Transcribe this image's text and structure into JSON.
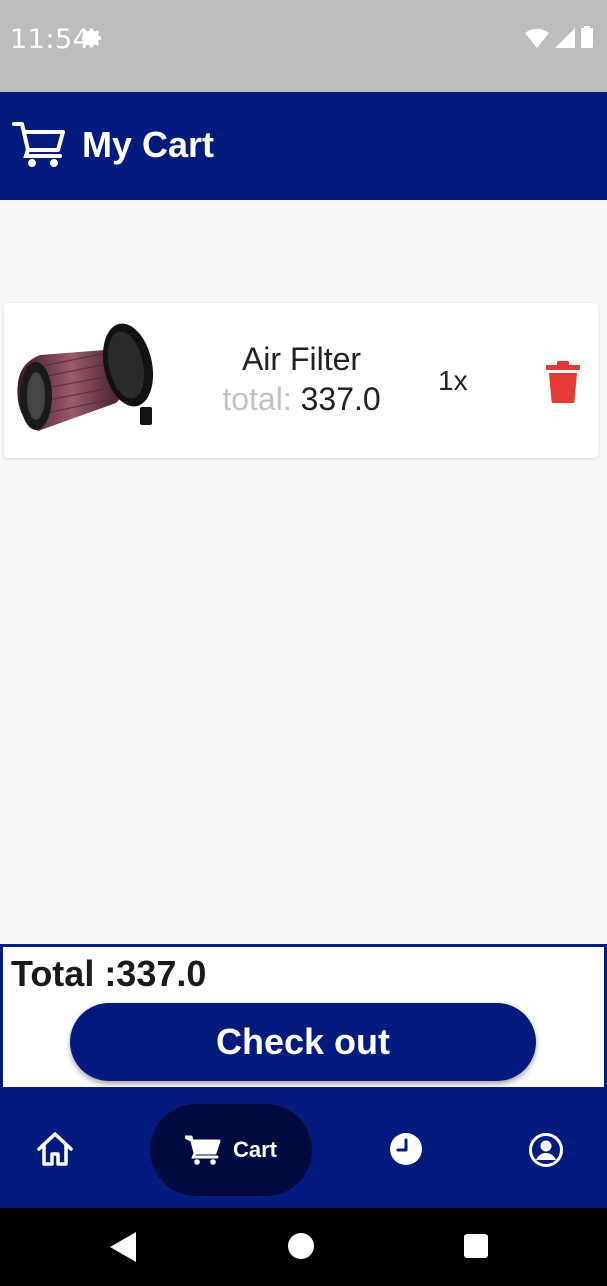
{
  "status_bar": {
    "time": "11:54",
    "icons": [
      "settings-icon",
      "wifi-icon",
      "signal-icon",
      "battery-icon"
    ]
  },
  "app_bar": {
    "title": "My Cart",
    "icon": "cart-icon",
    "background": "#031b7c"
  },
  "cart_items": [
    {
      "name": "Air Filter",
      "total_label": "total:",
      "total_value": "337.0",
      "quantity": "1x",
      "delete_icon": "trash-icon",
      "delete_color": "#e53935"
    }
  ],
  "summary": {
    "total_text": "Total :337.0",
    "checkout_label": "Check out"
  },
  "bottom_nav": {
    "items": [
      {
        "icon": "home-icon",
        "label": ""
      },
      {
        "icon": "cart-icon",
        "label": "Cart",
        "active": true
      },
      {
        "icon": "clock-icon",
        "label": ""
      },
      {
        "icon": "account-icon",
        "label": ""
      }
    ]
  },
  "system_nav": [
    "back-icon",
    "home-circle-icon",
    "recents-icon"
  ],
  "colors": {
    "primary": "#031b7c",
    "active_nav_pill": "#010a3f",
    "status_bar": "#bdbdbd",
    "delete": "#e53935"
  }
}
